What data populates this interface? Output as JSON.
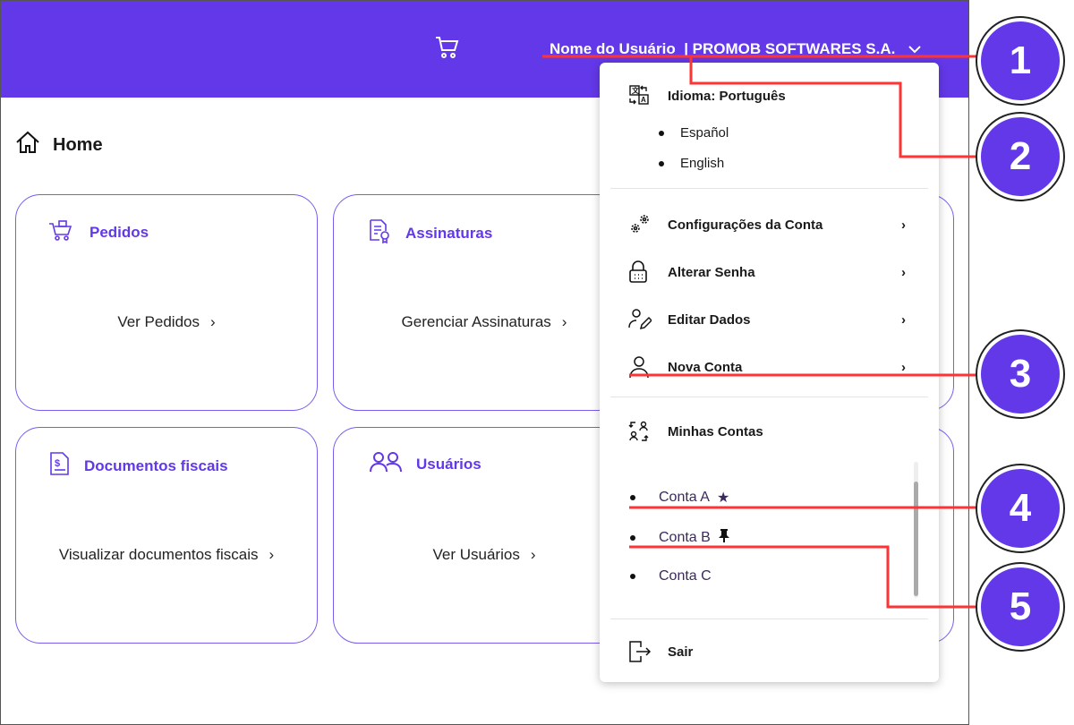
{
  "header": {
    "user_name": "Nome do Usuário",
    "company": "| PROMOB SOFTWARES S.A."
  },
  "breadcrumb": {
    "label": "Home"
  },
  "cards": [
    {
      "title": "Pedidos",
      "link": "Ver Pedidos"
    },
    {
      "title": "Assinaturas",
      "link": "Gerenciar Assinaturas"
    },
    {
      "title": "Documentos fiscais",
      "link": "Visualizar documentos fiscais"
    },
    {
      "title": "Usuários",
      "link": "Ver Usuários"
    }
  ],
  "menu": {
    "language": {
      "label": "Idioma: Português",
      "options": [
        "Español",
        "English"
      ]
    },
    "items": [
      "Configurações da Conta",
      "Alterar Senha",
      "Editar Dados",
      "Nova Conta"
    ],
    "accounts": {
      "label": "Minhas Contas",
      "list": [
        "Conta A",
        "Conta B",
        "Conta C"
      ]
    },
    "logout": "Sair"
  },
  "callouts": [
    "1",
    "2",
    "3",
    "4",
    "5"
  ],
  "colors": {
    "brand": "#6338e8",
    "annotation": "#ff3333"
  }
}
